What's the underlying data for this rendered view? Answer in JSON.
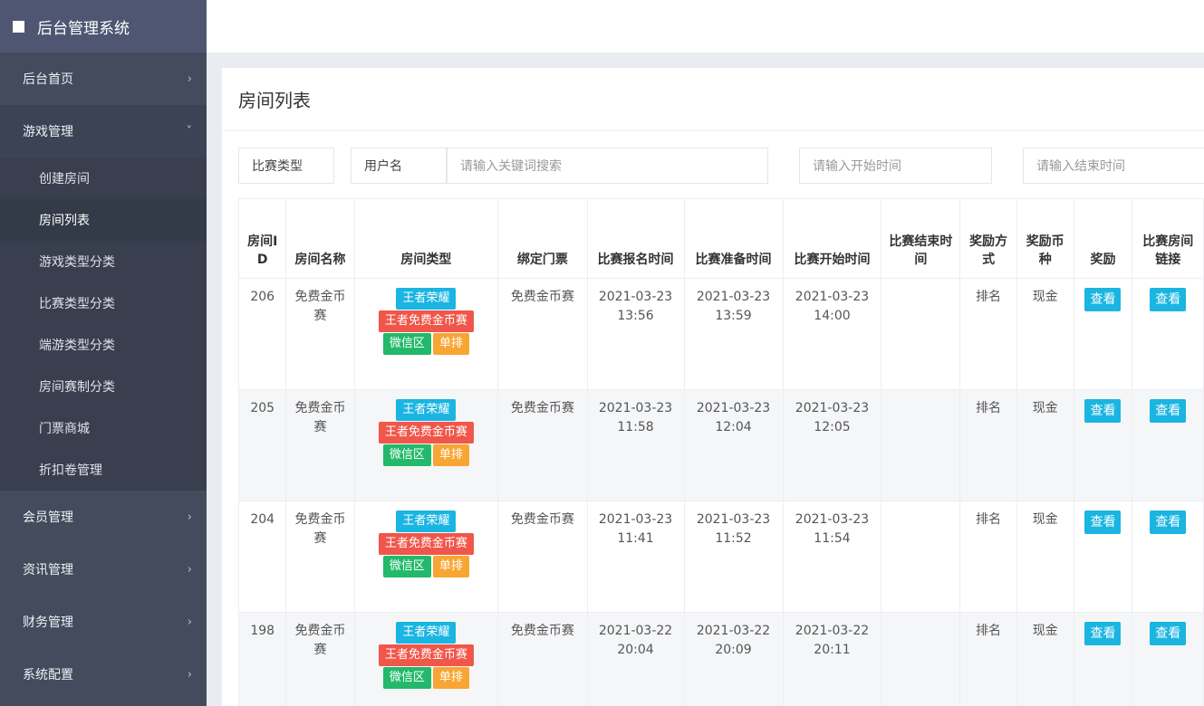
{
  "brand": {
    "title": "后台管理系统"
  },
  "sidebar": {
    "items": [
      {
        "label": "后台首页",
        "chevron": "›"
      },
      {
        "label": "游戏管理",
        "chevron": "˅"
      },
      {
        "label": "会员管理",
        "chevron": "›"
      },
      {
        "label": "资讯管理",
        "chevron": "›"
      },
      {
        "label": "财务管理",
        "chevron": "›"
      },
      {
        "label": "系统配置",
        "chevron": "›"
      }
    ],
    "subitems": [
      "创建房间",
      "房间列表",
      "游戏类型分类",
      "比赛类型分类",
      "端游类型分类",
      "房间赛制分类",
      "门票商城",
      "折扣卷管理"
    ]
  },
  "page": {
    "title": "房间列表"
  },
  "filters": {
    "match_type": "比赛类型",
    "username_label": "用户名",
    "keyword_placeholder": "请输入关键词搜索",
    "start_placeholder": "请输入开始时间",
    "end_placeholder": "请输入结束时间"
  },
  "table": {
    "headers": [
      "房间ID",
      "房间名称",
      "房间类型",
      "绑定门票",
      "比赛报名时间",
      "比赛准备时间",
      "比赛开始时间",
      "比赛结束时间",
      "奖励方式",
      "奖励币种",
      "奖励",
      "比赛房间链接"
    ],
    "rows": [
      {
        "id": "206",
        "name": "免费金币赛",
        "tags": [
          "王者荣耀",
          "王者免费金币赛",
          "微信区",
          "单排"
        ],
        "ticket": "免费金币赛",
        "signup_date": "2021-03-23",
        "signup_time": "13:56",
        "prep_date": "2021-03-23",
        "prep_time": "13:59",
        "start_date": "2021-03-23",
        "start_time": "14:00",
        "end": "",
        "reward_method": "排名",
        "currency": "现金",
        "reward_btn": "查看",
        "link_btn": "查看"
      },
      {
        "id": "205",
        "name": "免费金币赛",
        "tags": [
          "王者荣耀",
          "王者免费金币赛",
          "微信区",
          "单排"
        ],
        "ticket": "免费金币赛",
        "signup_date": "2021-03-23",
        "signup_time": "11:58",
        "prep_date": "2021-03-23",
        "prep_time": "12:04",
        "start_date": "2021-03-23",
        "start_time": "12:05",
        "end": "",
        "reward_method": "排名",
        "currency": "现金",
        "reward_btn": "查看",
        "link_btn": "查看"
      },
      {
        "id": "204",
        "name": "免费金币赛",
        "tags": [
          "王者荣耀",
          "王者免费金币赛",
          "微信区",
          "单排"
        ],
        "ticket": "免费金币赛",
        "signup_date": "2021-03-23",
        "signup_time": "11:41",
        "prep_date": "2021-03-23",
        "prep_time": "11:52",
        "start_date": "2021-03-23",
        "start_time": "11:54",
        "end": "",
        "reward_method": "排名",
        "currency": "现金",
        "reward_btn": "查看",
        "link_btn": "查看"
      },
      {
        "id": "198",
        "name": "免费金币赛",
        "tags": [
          "王者荣耀",
          "王者免费金币赛",
          "微信区",
          "单排"
        ],
        "ticket": "免费金币赛",
        "signup_date": "2021-03-22",
        "signup_time": "20:04",
        "prep_date": "2021-03-22",
        "prep_time": "20:09",
        "start_date": "2021-03-22",
        "start_time": "20:11",
        "end": "",
        "reward_method": "排名",
        "currency": "现金",
        "reward_btn": "查看",
        "link_btn": "查看"
      }
    ]
  },
  "colors": {
    "sidebar_bg": "#434b5d",
    "brand_bg": "#4e5672",
    "tag_blue": "#1ab5e1",
    "tag_red": "#f0564a",
    "tag_green": "#22b96a",
    "tag_orange": "#f9a533"
  },
  "icons": {
    "brand": "square-icon",
    "collapsed": "chevron-right-icon",
    "expanded": "chevron-down-icon"
  }
}
